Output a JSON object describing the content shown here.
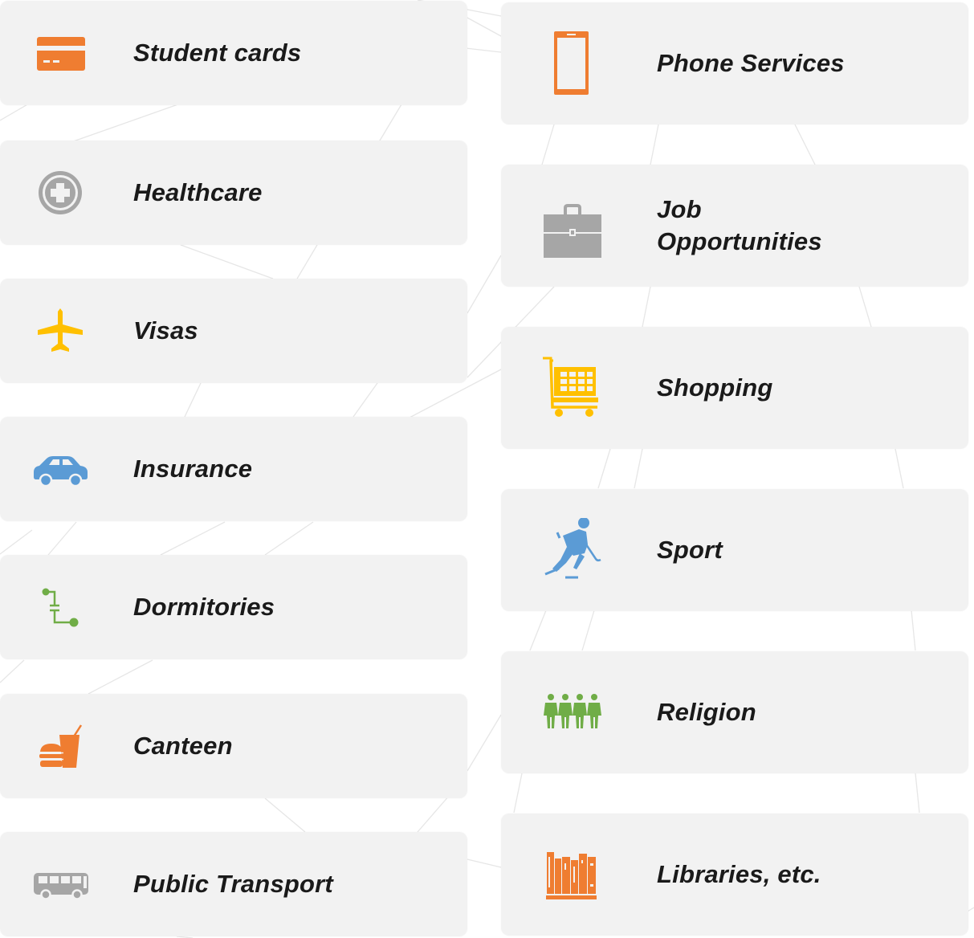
{
  "colors": {
    "card_background": "#f2f2f2",
    "label_text": "#1a1a1a",
    "background_lines": "#e6e6e6"
  },
  "left_column": [
    {
      "id": "student-cards",
      "label": "Student cards",
      "icon": "credit-card-icon",
      "color": "#ef7d31"
    },
    {
      "id": "healthcare",
      "label": "Healthcare",
      "icon": "medical-cross-icon",
      "color": "#a6a6a6"
    },
    {
      "id": "visas",
      "label": "Visas",
      "icon": "airplane-icon",
      "color": "#ffc000"
    },
    {
      "id": "insurance",
      "label": "Insurance",
      "icon": "car-icon",
      "color": "#5b9bd5"
    },
    {
      "id": "dormitories",
      "label": "Dormitories",
      "icon": "connector-icon",
      "color": "#70ad47"
    },
    {
      "id": "canteen",
      "label": "Canteen",
      "icon": "fast-food-icon",
      "color": "#ef7d31"
    },
    {
      "id": "public-transport",
      "label": "Public Transport",
      "icon": "bus-icon",
      "color": "#a6a6a6"
    }
  ],
  "right_column": [
    {
      "id": "phone-services",
      "label": "Phone Services",
      "icon": "smartphone-icon",
      "color": "#ef7d31"
    },
    {
      "id": "job-opportunities",
      "label": "Job\nOpportunities",
      "icon": "briefcase-icon",
      "color": "#a6a6a6"
    },
    {
      "id": "shopping",
      "label": "Shopping",
      "icon": "shopping-cart-icon",
      "color": "#ffc000"
    },
    {
      "id": "sport",
      "label": "Sport",
      "icon": "hockey-player-icon",
      "color": "#5b9bd5"
    },
    {
      "id": "religion",
      "label": "Religion",
      "icon": "people-group-icon",
      "color": "#70ad47"
    },
    {
      "id": "libraries",
      "label": "Libraries, etc.",
      "icon": "books-icon",
      "color": "#ef7d31"
    }
  ]
}
